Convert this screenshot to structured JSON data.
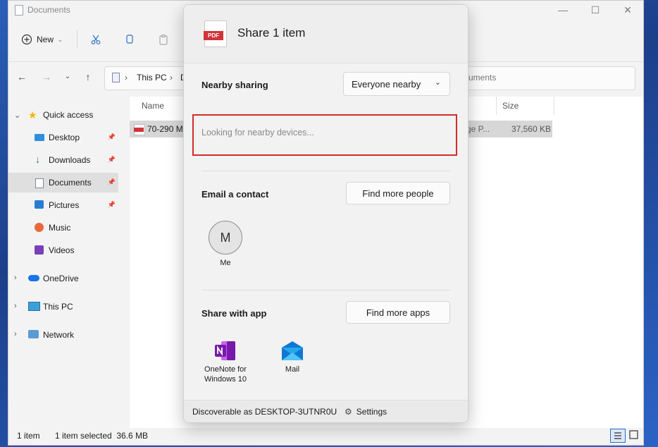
{
  "window": {
    "title": "Documents"
  },
  "toolbar": {
    "new_label": "New"
  },
  "address": {
    "crumb1": "This PC",
    "crumb2": "D",
    "search_tail": "uments"
  },
  "sidebar": {
    "items": [
      {
        "label": "Quick access",
        "icon": "star-icon"
      },
      {
        "label": "Desktop",
        "icon": "desktop-icon"
      },
      {
        "label": "Downloads",
        "icon": "download-icon"
      },
      {
        "label": "Documents",
        "icon": "documents-icon"
      },
      {
        "label": "Pictures",
        "icon": "pictures-icon"
      },
      {
        "label": "Music",
        "icon": "music-icon"
      },
      {
        "label": "Videos",
        "icon": "videos-icon"
      },
      {
        "label": "OneDrive",
        "icon": "cloud-icon"
      },
      {
        "label": "This PC",
        "icon": "monitor-icon"
      },
      {
        "label": "Network",
        "icon": "network-icon"
      }
    ]
  },
  "content": {
    "col_name": "Name",
    "col_size": "Size",
    "file": {
      "name": "70-290 Ma",
      "type_tail": "ge P...",
      "size": "37,560 KB"
    }
  },
  "statusbar": {
    "count": "1 item",
    "selected": "1 item selected  36.6 MB"
  },
  "share": {
    "title": "Share 1 item",
    "pdf_badge": "PDF",
    "nearby_label": "Nearby sharing",
    "nearby_dropdown": "Everyone nearby",
    "looking": "Looking for nearby devices...",
    "email_label": "Email a contact",
    "find_people": "Find more people",
    "contact_initial": "M",
    "contact_name": "Me",
    "app_label": "Share with app",
    "find_apps": "Find more apps",
    "apps": [
      {
        "line1": "OneNote for",
        "line2": "Windows 10",
        "icon": "onenote-icon"
      },
      {
        "line1": "Mail",
        "line2": "",
        "icon": "mail-icon"
      }
    ],
    "discoverable": "Discoverable as DESKTOP-3UTNR0U",
    "settings": "Settings"
  },
  "colors": {
    "accent_red": "#d42b2b",
    "pdf_red": "#d13438",
    "onenote": "#7719aa",
    "mail": "#0f78d4"
  }
}
